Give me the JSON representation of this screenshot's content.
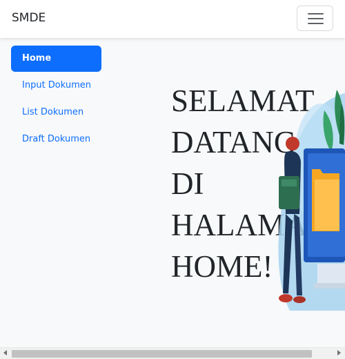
{
  "navbar": {
    "brand": "SMDE",
    "toggler_icon": "hamburger-menu-icon"
  },
  "sidebar": {
    "items": [
      {
        "label": "Home",
        "active": true
      },
      {
        "label": "Input Dokumen",
        "active": false
      },
      {
        "label": "List Dokumen",
        "active": false
      },
      {
        "label": "Draft Dokumen",
        "active": false
      }
    ]
  },
  "main": {
    "welcome_text": "SELAMAT\nDATANG\nDI\nHALAMAN\nHOME!",
    "illustration": "office-worker-document-illustration"
  },
  "colors": {
    "primary": "#0d6efd",
    "background": "#f8f9fa",
    "text": "#212529"
  }
}
